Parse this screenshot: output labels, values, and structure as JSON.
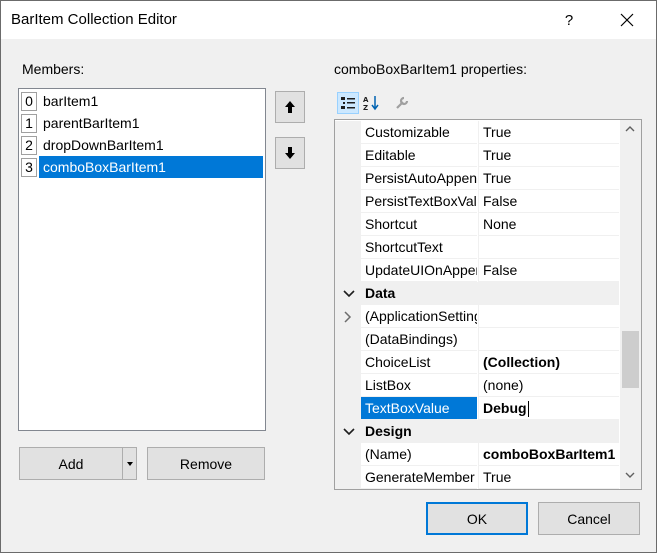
{
  "window": {
    "title": "BarItem Collection Editor",
    "help_label": "?"
  },
  "members": {
    "label": "Members:",
    "items": [
      {
        "index": "0",
        "name": "barItem1",
        "selected": false
      },
      {
        "index": "1",
        "name": "parentBarItem1",
        "selected": false
      },
      {
        "index": "2",
        "name": "dropDownBarItem1",
        "selected": false
      },
      {
        "index": "3",
        "name": "comboBoxBarItem1",
        "selected": true
      }
    ]
  },
  "buttons": {
    "add": "Add",
    "remove": "Remove",
    "ok": "OK",
    "cancel": "Cancel"
  },
  "properties": {
    "label": "comboBoxBarItem1 properties:",
    "toolbar": [
      "categorized-icon",
      "alphabetical-icon",
      "property-pages-icon"
    ],
    "rows": [
      {
        "type": "prop",
        "name": "Customizable",
        "value": "True"
      },
      {
        "type": "prop",
        "name": "Editable",
        "value": "True"
      },
      {
        "type": "prop",
        "name": "PersistAutoAppend",
        "value": "True"
      },
      {
        "type": "prop",
        "name": "PersistTextBoxValue",
        "value": "False"
      },
      {
        "type": "prop",
        "name": "Shortcut",
        "value": "None"
      },
      {
        "type": "prop",
        "name": "ShortcutText",
        "value": ""
      },
      {
        "type": "prop",
        "name": "UpdateUIOnAppend",
        "value": "False"
      },
      {
        "type": "category",
        "name": "Data"
      },
      {
        "type": "prop",
        "name": "(ApplicationSettings)",
        "value": "",
        "expandable": true
      },
      {
        "type": "prop",
        "name": "(DataBindings)",
        "value": ""
      },
      {
        "type": "prop",
        "name": "ChoiceList",
        "value": "(Collection)",
        "bold": true
      },
      {
        "type": "prop",
        "name": "ListBox",
        "value": "(none)"
      },
      {
        "type": "prop",
        "name": "TextBoxValue",
        "value": "Debug",
        "bold": true,
        "selected": true
      },
      {
        "type": "category",
        "name": "Design"
      },
      {
        "type": "prop",
        "name": "(Name)",
        "value": "comboBoxBarItem1",
        "bold": true
      },
      {
        "type": "prop",
        "name": "GenerateMember",
        "value": "True"
      }
    ]
  },
  "colors": {
    "selection": "#0078d7",
    "dialog_bg": "#f0f0f0"
  }
}
